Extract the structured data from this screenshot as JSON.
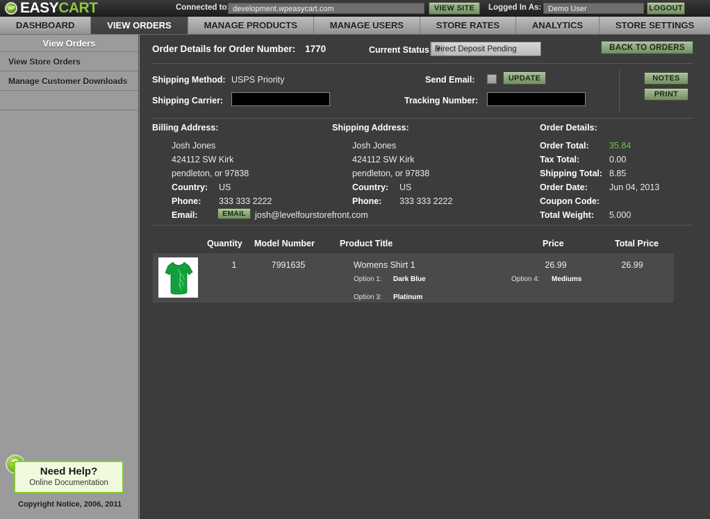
{
  "topbar": {
    "logo_easy": "EASY",
    "logo_cart": "CART",
    "logo_badge": "WP",
    "connected_label": "Connected to:",
    "connected_value": "development.wpeasycart.com",
    "view_site_label": "VIEW SITE",
    "logged_in_label": "Logged In As:",
    "logged_in_value": "Demo User",
    "logout_label": "LOGOUT"
  },
  "nav": {
    "items": [
      {
        "label": "DASHBOARD",
        "active": false
      },
      {
        "label": "VIEW ORDERS",
        "active": true
      },
      {
        "label": "MANAGE PRODUCTS",
        "active": false
      },
      {
        "label": "MANAGE USERS",
        "active": false
      },
      {
        "label": "STORE RATES",
        "active": false
      },
      {
        "label": "ANALYTICS",
        "active": false
      },
      {
        "label": "STORE SETTINGS",
        "active": false
      }
    ]
  },
  "sidebar": {
    "title": "View Orders",
    "items": [
      {
        "label": "View Store Orders"
      },
      {
        "label": "Manage Customer Downloads"
      }
    ],
    "help_title": "Need Help?",
    "help_subtitle": "Online Documentation",
    "help_icon": "?",
    "copyright": "Copyright  Notice, 2006, 2011"
  },
  "main": {
    "page_title": "Order Details for Order Number:",
    "order_number": "1770",
    "status_label": "Current Status:",
    "status_value": "Direct Deposit Pending",
    "back_to_orders_label": "BACK TO ORDERS",
    "shipping_method_label": "Shipping Method:",
    "shipping_method_value": "USPS Priority",
    "shipping_carrier_label": "Shipping Carrier:",
    "shipping_carrier_value": "",
    "send_email_label": "Send Email:",
    "update_label": "UPDATE",
    "tracking_number_label": "Tracking Number:",
    "tracking_number_value": "",
    "notes_label": "NOTES",
    "print_label": "PRINT",
    "billing": {
      "heading": "Billing Address:",
      "name": "Josh Jones",
      "street": "424112 SW Kirk",
      "citystate": "pendleton, or  97838",
      "country_label": "Country:",
      "country_value": "US",
      "phone_label": "Phone:",
      "phone_value": "333 333 2222",
      "email_label": "Email:",
      "email_button": "EMAIL",
      "email_value": "josh@levelfourstorefront.com"
    },
    "shipping": {
      "heading": "Shipping Address:",
      "name": "Josh Jones",
      "street": "424112 SW Kirk",
      "citystate": "pendleton, or  97838",
      "country_label": "Country:",
      "country_value": "US",
      "phone_label": "Phone:",
      "phone_value": "333 333 2222"
    },
    "order_details": {
      "heading": "Order Details:",
      "order_total_label": "Order Total:",
      "order_total_value": "35.84",
      "order_total_color": "#6fc34a",
      "tax_total_label": "Tax Total:",
      "tax_total_value": "0.00",
      "shipping_total_label": "Shipping Total:",
      "shipping_total_value": "8.85",
      "order_date_label": "Order Date:",
      "order_date_value": "Jun  04, 2013",
      "coupon_code_label": "Coupon Code:",
      "coupon_code_value": "",
      "total_weight_label": "Total Weight:",
      "total_weight_value": "5.000"
    },
    "table": {
      "headers": {
        "quantity": "Quantity",
        "model_number": "Model Number",
        "product_title": "Product Title",
        "price": "Price",
        "total_price": "Total Price"
      },
      "rows": [
        {
          "thumbnail": "green-womens-shirt-thumbnail",
          "quantity": "1",
          "model_number": "7991635",
          "product_title": "Womens Shirt 1",
          "price": "26.99",
          "total_price": "26.99",
          "options": [
            {
              "label": "Option 1:",
              "value": "Dark Blue"
            },
            {
              "label": "Option 3:",
              "value": "Platinum"
            },
            {
              "label": "Option 4:",
              "value": "Mediums"
            }
          ]
        }
      ]
    }
  }
}
